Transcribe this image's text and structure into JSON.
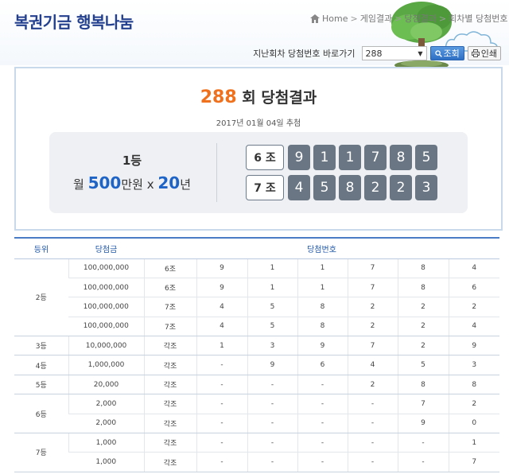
{
  "header": {
    "title": "복권기금 행복나눔",
    "breadcrumb": [
      "Home",
      "게임결과",
      "당첨결과",
      "회차별 당첨번호"
    ]
  },
  "search": {
    "label": "지난회차 당첨번호 바로가기",
    "selected_round": "288",
    "search_button": "조회",
    "print_button": "인쇄"
  },
  "result": {
    "round": "288",
    "round_suffix": "회 당첨결과",
    "draw_date": "2017년 01월 04일 추첨",
    "first_prize": {
      "rank": "1등",
      "amount_prefix": "월",
      "amount_value": "500",
      "amount_unit": "만원 x",
      "years_value": "20",
      "years_unit": "년"
    },
    "winning_sets": [
      {
        "group": "6 조",
        "numbers": [
          "9",
          "1",
          "1",
          "7",
          "8",
          "5"
        ]
      },
      {
        "group": "7 조",
        "numbers": [
          "4",
          "5",
          "8",
          "2",
          "2",
          "3"
        ]
      }
    ]
  },
  "table": {
    "headers": {
      "rank": "등위",
      "prize": "당첨금",
      "numbers": "당첨번호"
    },
    "groups": [
      {
        "rank": "2등",
        "rows": [
          {
            "prize": "100,000,000",
            "group": "6조",
            "numbers": [
              "9",
              "1",
              "1",
              "7",
              "8",
              "4"
            ]
          },
          {
            "prize": "100,000,000",
            "group": "6조",
            "numbers": [
              "9",
              "1",
              "1",
              "7",
              "8",
              "6"
            ]
          },
          {
            "prize": "100,000,000",
            "group": "7조",
            "numbers": [
              "4",
              "5",
              "8",
              "2",
              "2",
              "2"
            ]
          },
          {
            "prize": "100,000,000",
            "group": "7조",
            "numbers": [
              "4",
              "5",
              "8",
              "2",
              "2",
              "4"
            ]
          }
        ]
      },
      {
        "rank": "3등",
        "rows": [
          {
            "prize": "10,000,000",
            "group": "각조",
            "numbers": [
              "1",
              "3",
              "9",
              "7",
              "2",
              "9"
            ]
          }
        ]
      },
      {
        "rank": "4등",
        "rows": [
          {
            "prize": "1,000,000",
            "group": "각조",
            "numbers": [
              "-",
              "9",
              "6",
              "4",
              "5",
              "3"
            ]
          }
        ]
      },
      {
        "rank": "5등",
        "rows": [
          {
            "prize": "20,000",
            "group": "각조",
            "numbers": [
              "-",
              "-",
              "-",
              "2",
              "8",
              "8"
            ]
          }
        ]
      },
      {
        "rank": "6등",
        "rows": [
          {
            "prize": "2,000",
            "group": "각조",
            "numbers": [
              "-",
              "-",
              "-",
              "-",
              "7",
              "2"
            ]
          },
          {
            "prize": "2,000",
            "group": "각조",
            "numbers": [
              "-",
              "-",
              "-",
              "-",
              "9",
              "0"
            ]
          }
        ]
      },
      {
        "rank": "7등",
        "rows": [
          {
            "prize": "1,000",
            "group": "각조",
            "numbers": [
              "-",
              "-",
              "-",
              "-",
              "-",
              "1"
            ]
          },
          {
            "prize": "1,000",
            "group": "각조",
            "numbers": [
              "-",
              "-",
              "-",
              "-",
              "-",
              "7"
            ]
          }
        ]
      }
    ]
  },
  "colors": {
    "accent_orange": "#f0711d",
    "accent_blue": "#1e63c6",
    "ball_gray": "#6a7684",
    "title_navy": "#23408e"
  },
  "icons": [
    "home-icon",
    "search-icon",
    "print-icon",
    "tree-illustration"
  ]
}
